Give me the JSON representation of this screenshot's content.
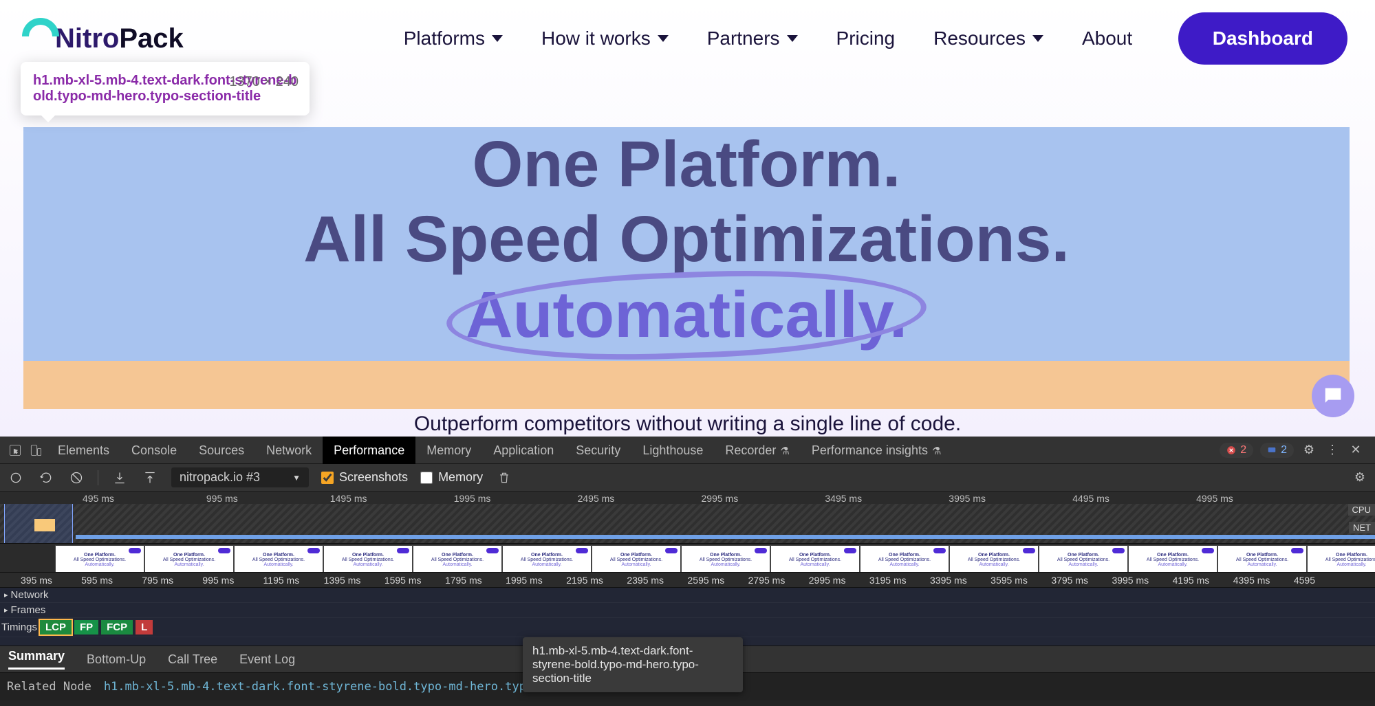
{
  "page": {
    "logo": {
      "nitro": "Nitro",
      "pack": "Pack"
    },
    "nav": {
      "platforms": "Platforms",
      "how": "How it works",
      "partners": "Partners",
      "pricing": "Pricing",
      "resources": "Resources",
      "about": "About"
    },
    "dashboard_btn": "Dashboard",
    "inspect_tooltip": {
      "selector": "h1.mb-xl-5.mb-4.text-dark.font-styrene-bold.typo-md-hero.typo-section-title",
      "dimensions": "1370 × 240"
    },
    "hero": {
      "l1": "One Platform.",
      "l2": "All Speed Optimizations.",
      "l3": "Automatically."
    },
    "tagline": "Outperform competitors without writing a single line of code."
  },
  "devtools": {
    "tabs": [
      "Elements",
      "Console",
      "Sources",
      "Network",
      "Performance",
      "Memory",
      "Application",
      "Security",
      "Lighthouse",
      "Recorder",
      "Performance insights"
    ],
    "active_tab": "Performance",
    "flask_tabs": [
      "Recorder",
      "Performance insights"
    ],
    "error_count": "2",
    "message_count": "2",
    "toolbar": {
      "recording_label": "nitropack.io #3",
      "screenshots_label": "Screenshots",
      "screenshots_checked": true,
      "memory_label": "Memory",
      "memory_checked": false
    },
    "overview_ticks": [
      "495 ms",
      "995 ms",
      "1495 ms",
      "1995 ms",
      "2495 ms",
      "2995 ms",
      "3495 ms",
      "3995 ms",
      "4495 ms",
      "4995 ms"
    ],
    "side_cpu": "CPU",
    "side_net": "NET",
    "filmstrip_lines": [
      "One Platform.",
      "All Speed Optimizations.",
      "Automatically."
    ],
    "filmstrip_count": 15,
    "main_ticks": [
      "395 ms",
      "595 ms",
      "795 ms",
      "995 ms",
      "1195 ms",
      "1395 ms",
      "1595 ms",
      "1795 ms",
      "1995 ms",
      "2195 ms",
      "2395 ms",
      "2595 ms",
      "2795 ms",
      "2995 ms",
      "3195 ms",
      "3395 ms",
      "3595 ms",
      "3795 ms",
      "3995 ms",
      "4195 ms",
      "4395 ms",
      "4595"
    ],
    "tracks": {
      "network": "Network",
      "frames": "Frames",
      "timings": "Timings"
    },
    "timing_badges": {
      "lcp": "LCP",
      "fp": "FP",
      "fcp": "FCP",
      "l": "L"
    },
    "lcp_tooltip": "h1.mb-xl-5.mb-4.text-dark.font-styrene-bold.typo-md-hero.typo-section-title",
    "bottom_tabs": [
      "Summary",
      "Bottom-Up",
      "Call Tree",
      "Event Log"
    ],
    "bottom_active": "Summary",
    "related": {
      "label": "Related Node",
      "value": "h1.mb-xl-5.mb-4.text-dark.font-styrene-bold.typo-md-hero.typo-section-title"
    }
  }
}
